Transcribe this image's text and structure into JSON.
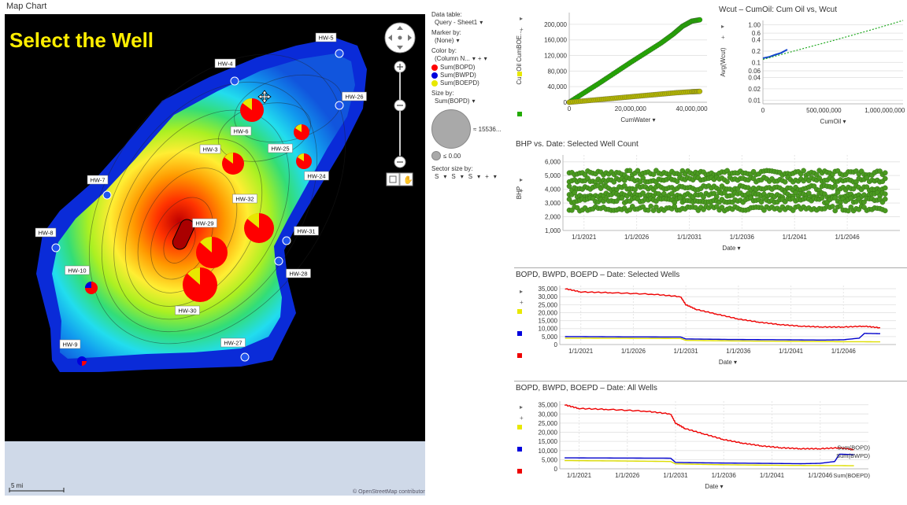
{
  "map": {
    "panel_title": "Map Chart",
    "overlay_title": "Select the Well",
    "scale_label": "5 mi",
    "attribution": "© OpenStreetMap contributors",
    "wells": [
      {
        "id": "HW-5",
        "pie": false
      },
      {
        "id": "HW-4",
        "pie": false
      },
      {
        "id": "HW-26",
        "pie": false
      },
      {
        "id": "HW-6",
        "pie": true
      },
      {
        "id": "HW-25",
        "pie": true
      },
      {
        "id": "HW-3",
        "pie": true
      },
      {
        "id": "HW-24",
        "pie": true
      },
      {
        "id": "HW-7",
        "pie": false
      },
      {
        "id": "HW-32",
        "pie": true
      },
      {
        "id": "HW-29",
        "pie": true
      },
      {
        "id": "HW-31",
        "pie": false
      },
      {
        "id": "HW-8",
        "pie": false
      },
      {
        "id": "HW-28",
        "pie": false
      },
      {
        "id": "HW-10",
        "pie": true
      },
      {
        "id": "HW-30",
        "pie": true
      },
      {
        "id": "HW-27",
        "pie": false
      },
      {
        "id": "HW-9",
        "pie": true
      }
    ]
  },
  "legend": {
    "data_table_label": "Data table:",
    "data_table_value": "Query - Sheet1",
    "marker_by_label": "Marker by:",
    "marker_by_value": "(None)",
    "color_by_label": "Color by:",
    "color_by_value": "(Column N...",
    "series": [
      {
        "name": "Sum(BOPD)",
        "color": "#ff0000"
      },
      {
        "name": "Sum(BWPD)",
        "color": "#0000dd"
      },
      {
        "name": "Sum(BOEPD)",
        "color": "#e8e800"
      }
    ],
    "size_by_label": "Size by:",
    "size_by_value": "Sum(BOPD)",
    "size_max": "≈ 15536...",
    "size_min": "≤ 0.00",
    "sector_size_label": "Sector size by:",
    "sector_values": [
      "S",
      "S",
      "S"
    ]
  },
  "chart_data": [
    {
      "type": "scatter",
      "title": "",
      "xlabel": "CumWater",
      "ylabel": "CumOil  CumBOE...",
      "x_ticks": [
        "0",
        "20,000,000",
        "40,000,000"
      ],
      "y_ticks": [
        "0",
        "40,000",
        "80,000",
        "120,000",
        "160,000",
        "200,000"
      ],
      "xlim": [
        0,
        45000000
      ],
      "ylim": [
        0,
        230000
      ],
      "series": [
        {
          "name": "",
          "color": "#22aa00",
          "x": [
            0,
            5000000,
            10000000,
            15000000,
            20000000,
            25000000,
            30000000,
            34000000,
            37000000,
            40000000,
            43000000
          ],
          "y": [
            0,
            25000,
            50000,
            76000,
            102000,
            127000,
            152000,
            175000,
            195000,
            208000,
            212000
          ]
        },
        {
          "name": "",
          "color": "#b5b800",
          "x": [
            0,
            5000000,
            10000000,
            15000000,
            20000000,
            25000000,
            30000000,
            35000000,
            40000000,
            43000000
          ],
          "y": [
            0,
            3500,
            7000,
            10500,
            14000,
            17500,
            21000,
            24500,
            27000,
            28000
          ]
        }
      ]
    },
    {
      "type": "scatter",
      "title": "Wcut – CumOil: Cum Oil vs, Wcut",
      "xlabel": "CumOil",
      "ylabel": "Avg(Wcut)",
      "x_ticks": [
        "0",
        "500,000,000",
        "1,000,000,000"
      ],
      "y_ticks": [
        "0.01",
        "0.02",
        "0.04",
        "0.06",
        "0.1",
        "0.2",
        "0.4",
        "0.6",
        "1.00"
      ],
      "y_scale": "log",
      "xlim": [
        0,
        1150000000
      ],
      "ylim": [
        0.008,
        1.3
      ],
      "series": [
        {
          "name": "",
          "color": "#1144cc",
          "x": [
            0,
            50000000,
            100000000,
            150000000,
            200000000
          ],
          "y": [
            0.13,
            0.14,
            0.16,
            0.18,
            0.22
          ]
        },
        {
          "name": "",
          "color": "#22aa22",
          "dashed": true,
          "x": [
            0,
            300000000,
            600000000,
            900000000,
            1150000000
          ],
          "y": [
            0.12,
            0.22,
            0.4,
            0.75,
            1.3
          ]
        }
      ]
    },
    {
      "type": "scatter",
      "title": "BHP vs. Date: Selected Well Count",
      "xlabel": "Date",
      "ylabel": "BHP",
      "x_ticks": [
        "1/1/2021",
        "1/1/2026",
        "1/1/2031",
        "1/1/2036",
        "1/1/2041",
        "1/1/2046"
      ],
      "y_ticks": [
        "1,000",
        "2,000",
        "3,000",
        "4,000",
        "5,000",
        "6,000"
      ],
      "xlim": [
        2019,
        2051
      ],
      "ylim": [
        1000,
        6500
      ],
      "bands": [
        5200,
        4700,
        4100,
        3600,
        3200,
        2600
      ],
      "series": [
        {
          "name": "",
          "color": "#4a9a20"
        }
      ]
    },
    {
      "type": "line",
      "title": "BOPD, BWPD, BOEPD – Date: Selected Wells",
      "xlabel": "Date",
      "ylabel": "",
      "x_ticks": [
        "1/1/2021",
        "1/1/2026",
        "1/1/2031",
        "1/1/2036",
        "1/1/2041",
        "1/1/2046"
      ],
      "y_ticks": [
        "0",
        "5,000",
        "10,000",
        "15,000",
        "20,000",
        "25,000",
        "30,000",
        "35,000"
      ],
      "xlim": [
        2019,
        2051
      ],
      "ylim": [
        0,
        37000
      ],
      "series": [
        {
          "name": "",
          "color": "#ee0000",
          "x": [
            2019.5,
            2021,
            2024,
            2028,
            2030.5,
            2031,
            2032,
            2034,
            2036,
            2038,
            2040,
            2042,
            2044,
            2046,
            2048,
            2049.5
          ],
          "y": [
            35000,
            33000,
            32500,
            31500,
            30000,
            25000,
            22000,
            19000,
            16000,
            14000,
            12500,
            11500,
            11000,
            11000,
            11500,
            10500
          ]
        },
        {
          "name": "",
          "color": "#0000cc",
          "x": [
            2019.5,
            2025,
            2030.5,
            2031,
            2035,
            2040,
            2044,
            2046,
            2047.5,
            2048,
            2049.5
          ],
          "y": [
            5000,
            4800,
            4700,
            3500,
            3200,
            3000,
            2800,
            3000,
            4000,
            7000,
            6800
          ]
        },
        {
          "name": "",
          "color": "#dddd00",
          "x": [
            2019.5,
            2025,
            2030.5,
            2031,
            2035,
            2040,
            2045,
            2049.5
          ],
          "y": [
            4000,
            3900,
            3800,
            2600,
            2300,
            2000,
            1800,
            1700
          ]
        }
      ]
    },
    {
      "type": "line",
      "title": "BOPD, BWPD, BOEPD – Date: All Wells",
      "xlabel": "Date",
      "ylabel": "",
      "x_ticks": [
        "1/1/2021",
        "1/1/2026",
        "1/1/2031",
        "1/1/2036",
        "1/1/2041",
        "1/1/2046"
      ],
      "y_ticks": [
        "0",
        "5,000",
        "10,000",
        "15,000",
        "20,000",
        "25,000",
        "30,000",
        "35,000"
      ],
      "xlim": [
        2019,
        2051
      ],
      "ylim": [
        0,
        37000
      ],
      "series": [
        {
          "name": "Sum(BOPD)",
          "color": "#ee0000",
          "x": [
            2019.5,
            2021,
            2024,
            2028,
            2030.5,
            2031,
            2032,
            2034,
            2036,
            2038,
            2040,
            2042,
            2044,
            2046,
            2048,
            2049.5
          ],
          "y": [
            35000,
            33000,
            32500,
            31500,
            30000,
            25000,
            22000,
            19000,
            16000,
            14000,
            12500,
            11500,
            11000,
            11000,
            11500,
            10500
          ]
        },
        {
          "name": "Sum(BWPD)",
          "color": "#0000cc",
          "x": [
            2019.5,
            2025,
            2030.5,
            2031,
            2035,
            2040,
            2044,
            2046,
            2047.5,
            2048,
            2049.5
          ],
          "y": [
            6000,
            5900,
            5800,
            3500,
            3200,
            3000,
            2800,
            3000,
            4000,
            8000,
            7800
          ]
        },
        {
          "name": "Sum(BOEPD)",
          "color": "#dddd00",
          "x": [
            2019.5,
            2025,
            2030.5,
            2031,
            2035,
            2040,
            2045,
            2049.5
          ],
          "y": [
            4500,
            4300,
            4000,
            2700,
            2300,
            2000,
            1800,
            1700
          ]
        }
      ]
    }
  ]
}
